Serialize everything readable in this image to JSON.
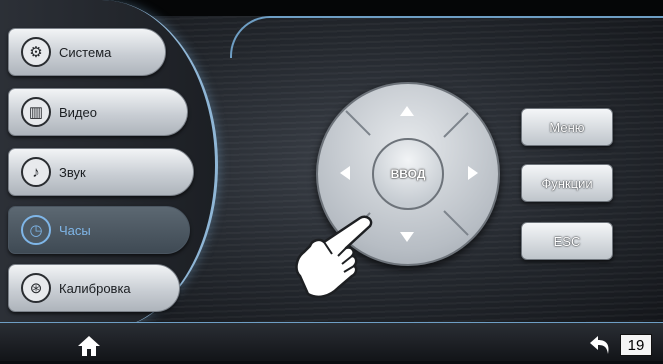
{
  "sidebar": {
    "items": [
      {
        "label": "Система",
        "icon": "gear-icon"
      },
      {
        "label": "Видео",
        "icon": "film-icon"
      },
      {
        "label": "Звук",
        "icon": "music-note-icon"
      },
      {
        "label": "Часы",
        "icon": "clock-icon",
        "active": true
      },
      {
        "label": "Калибровка",
        "icon": "calibration-icon"
      }
    ]
  },
  "dpad": {
    "enter_label": "ВВОД",
    "arrows": [
      "up",
      "down",
      "left",
      "right"
    ]
  },
  "side_buttons": {
    "menu": "Меню",
    "functions": "Функции",
    "esc": "ESC"
  },
  "bottom_bar": {
    "home_icon": "home-icon",
    "back_icon": "back-arrow-icon"
  },
  "page_number": "19",
  "colors": {
    "accent": "#7fb6e8",
    "glow": "#8fb6d6",
    "button_face": "#e6e9ec"
  }
}
